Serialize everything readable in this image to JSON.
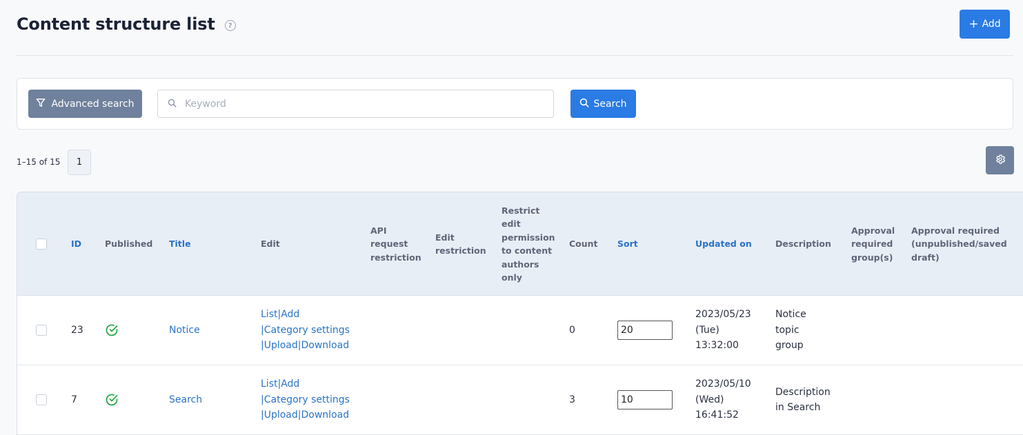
{
  "header": {
    "title": "Content structure list",
    "help_icon": "?",
    "add_label": "Add",
    "add_icon": "+"
  },
  "search": {
    "advanced_label": "Advanced search",
    "keyword_placeholder": "Keyword",
    "keyword_value": "",
    "search_label": "Search"
  },
  "pagination": {
    "range_label": "1–15 of 15",
    "current_page": "1"
  },
  "table": {
    "columns": {
      "id": "ID",
      "published": "Published",
      "title": "Title",
      "edit": "Edit",
      "api_restriction": "API request restriction",
      "edit_restriction": "Edit restriction",
      "restrict_authors": "Restrict edit permission to content authors only",
      "count": "Count",
      "sort": "Sort",
      "updated_on": "Updated on",
      "description": "Description",
      "approval_groups": "Approval required group(s)",
      "approval_required": "Approval required (unpublished/saved draft)"
    },
    "rows": [
      {
        "id": "23",
        "title": "Notice",
        "edit_list": "List",
        "edit_add": "Add",
        "edit_category": "Category settings",
        "edit_upload": "Upload",
        "edit_download": "Download",
        "count": "0",
        "sort": "20",
        "updated_date": "2023/05/23",
        "updated_day": "(Tue)",
        "updated_time": "13:32:00",
        "description": "Notice topic group"
      },
      {
        "id": "7",
        "title": "Search",
        "edit_list": "List",
        "edit_add": "Add",
        "edit_category": "Category settings",
        "edit_upload": "Upload",
        "edit_download": "Download",
        "count": "3",
        "sort": "10",
        "updated_date": "2023/05/10",
        "updated_day": "(Wed)",
        "updated_time": "16:41:52",
        "description": "Description in Search"
      }
    ]
  },
  "colors": {
    "primary": "#2a7be4",
    "secondary": "#6f819c",
    "link": "#2a73c8",
    "published_check": "#28a745"
  }
}
